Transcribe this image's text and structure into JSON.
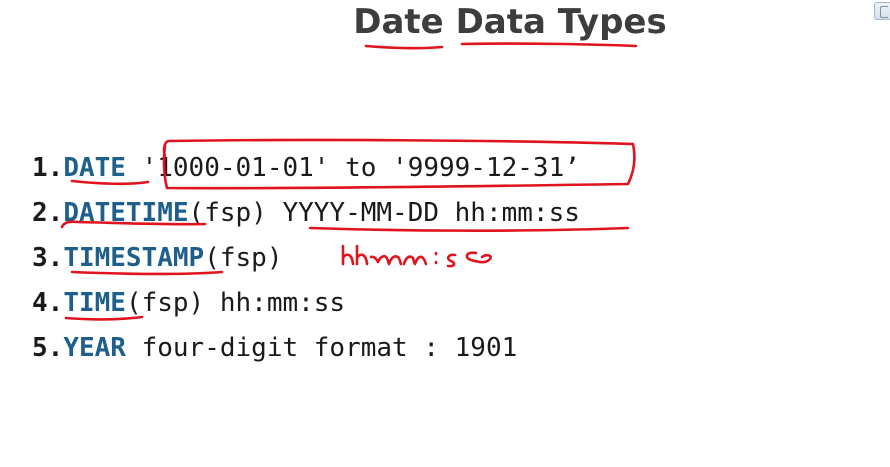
{
  "slide": {
    "title": "Date Data Types",
    "items": [
      {
        "num": "1.",
        "keyword": "DATE",
        "rest": " '1000-01-01' to '9999-12-31’"
      },
      {
        "num": "2.",
        "keyword": "DATETIME",
        "rest": "(fsp) YYYY-MM-DD hh:mm:ss"
      },
      {
        "num": "3.",
        "keyword": "TIMESTAMP",
        "rest": "(fsp)"
      },
      {
        "num": "4.",
        "keyword": "TIME",
        "rest": "(fsp) hh:mm:ss"
      },
      {
        "num": "5.",
        "keyword": "YEAR",
        "rest": " four-digit format : 1901"
      }
    ],
    "handwritten_note": "hh:mm:ss",
    "colors": {
      "keyword": "#1f5f8b",
      "title": "#3d3d3d",
      "ink": "#e0141e"
    }
  }
}
